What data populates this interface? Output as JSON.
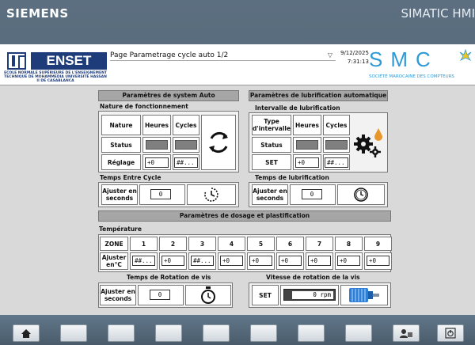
{
  "frame": {
    "brand": "SIEMENS",
    "product": "SIMATIC HMI"
  },
  "header": {
    "school_logo_text": "ENSET",
    "school_subtitle": "ECOLE NORMALE SUPÉRIEURE DE L'ENSEIGNEMENT TECHNIQUE DE MOHAMMEDIA UNIVERSITÉ HASSAN II DE CASABLANCA",
    "page_title": "Page Parametrage cycle auto 1/2",
    "date": "9/12/2025",
    "time": "7:31:13",
    "company_letters": "SMC",
    "company_subtitle": "SOCIÉTÉ MAROCAINE DES COMPTEURS"
  },
  "system_auto": {
    "title": "Paramètres de system Auto",
    "nature_label": "Nature de fonctionnement",
    "col_nature": "Nature",
    "col_heures": "Heures",
    "col_cycles": "Cycles",
    "row_status": "Status",
    "row_reglage": "Réglage",
    "reglage_heures": "+0",
    "reglage_cycles": "##...",
    "temps_entre_cycle_label": "Temps Entre Cycle",
    "ajuster_label": "Ajuster en seconds",
    "ajuster_value": "0"
  },
  "lubrification": {
    "title": "Paramètres  de lubrification automatique",
    "intervalle_label": "Intervalle de lubrification",
    "col_type": "Type d'intervalle",
    "col_heures": "Heures",
    "col_cycles": "Cycles",
    "row_status": "Status",
    "row_set": "SET",
    "set_heures": "+0",
    "set_cycles": "##...",
    "temps_label": "Temps de lubrification",
    "ajuster_label": "Ajuster en seconds",
    "ajuster_value": "0"
  },
  "dosage": {
    "title": "Paramètres de dosage et plastification",
    "temperature_label": "Température",
    "zone_label": "ZONE",
    "zones": [
      "1",
      "2",
      "3",
      "4",
      "5",
      "6",
      "7",
      "8",
      "9"
    ],
    "ajuster_label": "Ajuster en°C",
    "values": [
      "##...",
      "+0",
      "##...",
      "+0",
      "+0",
      "+0",
      "+0",
      "+0",
      "+0"
    ],
    "rotation_time_label": "Temps de Rotation de vis",
    "rotation_ajuster_label": "Ajuster en seconds",
    "rotation_ajuster_value": "0",
    "speed_label": "Vitesse de rotation de la vis",
    "speed_set_label": "SET",
    "speed_value": "0 rpm"
  },
  "icons": {
    "cycle": "cycle-arrows-icon",
    "gears_oil": "gears-oil-icon",
    "timer": "timer-icon",
    "clock": "clock-icon",
    "stopwatch": "stopwatch-icon",
    "motor": "motor-icon",
    "home": "home-icon",
    "user": "user-icon",
    "exit": "exit-icon"
  }
}
